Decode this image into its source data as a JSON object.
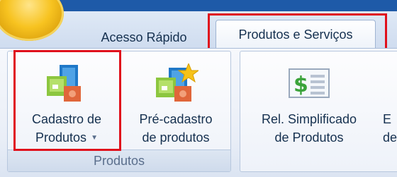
{
  "tabs": [
    {
      "label": "Acesso Rápido"
    },
    {
      "label": "Produtos e Serviços"
    }
  ],
  "groups": [
    {
      "label": "Produtos"
    }
  ],
  "buttons": {
    "cadastro": {
      "line1": "Cadastro de",
      "line2": "Produtos",
      "has_dropdown": true,
      "icon": "product-register-icon"
    },
    "pre_cadastro": {
      "line1": "Pré-cadastro",
      "line2": "de produtos",
      "icon": "product-preregister-star-icon"
    },
    "rel_simplificado": {
      "line1": "Rel. Simplificado",
      "line2": "de Produtos",
      "icon": "money-report-icon"
    },
    "partial": {
      "line1": "E",
      "line2": "de"
    }
  },
  "dropdown_glyph": "▼",
  "highlights": {
    "color": "#e0101c"
  }
}
